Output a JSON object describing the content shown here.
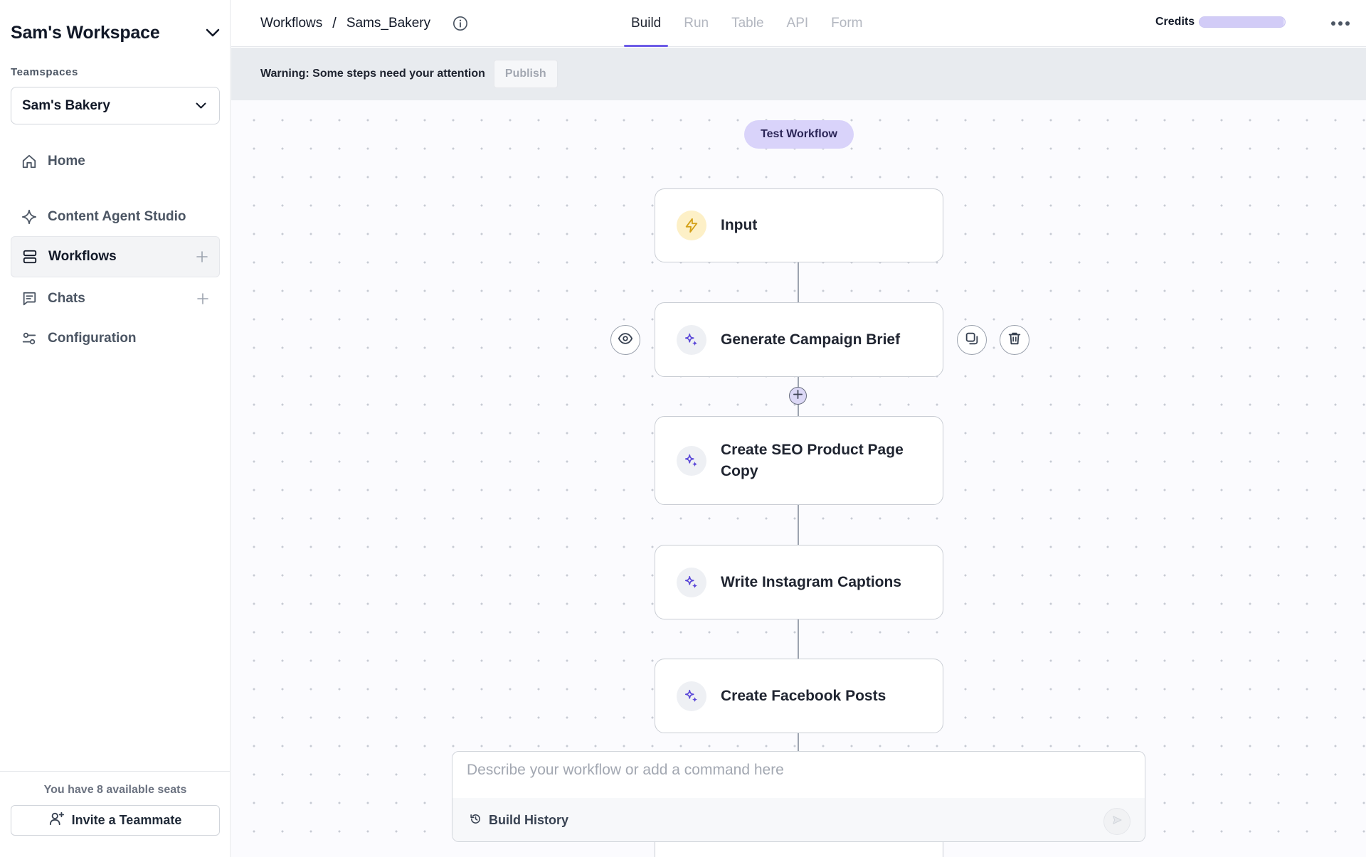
{
  "sidebar": {
    "workspace_title": "Sam's Workspace",
    "teamspaces_label": "Teamspaces",
    "teamspace_selected": "Sam's Bakery",
    "items": [
      {
        "label": "Home",
        "icon": "home-icon"
      },
      {
        "label": "Content Agent Studio",
        "icon": "sparkle-outline-icon"
      },
      {
        "label": "Workflows",
        "icon": "workflows-icon",
        "active": true,
        "has_add": true
      },
      {
        "label": "Chats",
        "icon": "chat-icon",
        "has_add": true
      },
      {
        "label": "Configuration",
        "icon": "sliders-icon"
      }
    ],
    "seats_text": "You have 8 available seats",
    "invite_label": "Invite a Teammate"
  },
  "header": {
    "breadcrumb": [
      "Workflows",
      "Sams_Bakery"
    ],
    "breadcrumb_separator": "/",
    "tabs": [
      {
        "label": "Build",
        "active": true
      },
      {
        "label": "Run"
      },
      {
        "label": "Table"
      },
      {
        "label": "API"
      },
      {
        "label": "Form"
      }
    ],
    "credits_label": "Credits",
    "credits_fill": 0.98
  },
  "warning": {
    "text": "Warning: Some steps need your attention",
    "publish_label": "Publish"
  },
  "canvas": {
    "test_workflow_label": "Test Workflow",
    "steps": [
      {
        "label": "Input",
        "icon": "lightning-icon"
      },
      {
        "label": "Generate Campaign Brief",
        "icon": "sparkles-icon",
        "selected": true
      },
      {
        "label": "Create SEO Product Page Copy",
        "icon": "sparkles-icon"
      },
      {
        "label": "Write Instagram Captions",
        "icon": "sparkles-icon"
      },
      {
        "label": "Create Facebook Posts",
        "icon": "sparkles-icon"
      }
    ]
  },
  "command": {
    "placeholder": "Describe your workflow or add a command here",
    "build_history_label": "Build History"
  },
  "colors": {
    "accent": "#6d5ce7",
    "test_button_bg": "#d9d3fa",
    "input_icon_bg": "#fdf0c7",
    "warning_bg": "#e8ebef"
  }
}
